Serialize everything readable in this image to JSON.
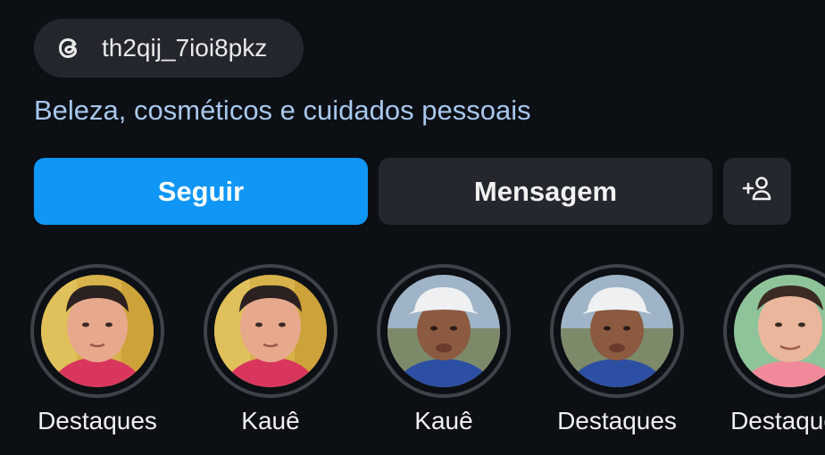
{
  "threads": {
    "handle": "th2qij_7ioi8pkz",
    "icon": "threads-icon"
  },
  "profile": {
    "category": "Beleza, cosméticos e cuidados pessoais"
  },
  "actions": {
    "follow_label": "Seguir",
    "message_label": "Mensagem",
    "add_user_icon": "add-person-icon"
  },
  "highlights": [
    {
      "label": "Destaques"
    },
    {
      "label": "Kauê"
    },
    {
      "label": "Kauê"
    },
    {
      "label": "Destaques"
    },
    {
      "label": "Destaques"
    }
  ],
  "colors": {
    "background": "#0c0f14",
    "follow_button": "#0f96f6",
    "secondary_button": "#24272e",
    "category_text": "#a8c7ec"
  }
}
